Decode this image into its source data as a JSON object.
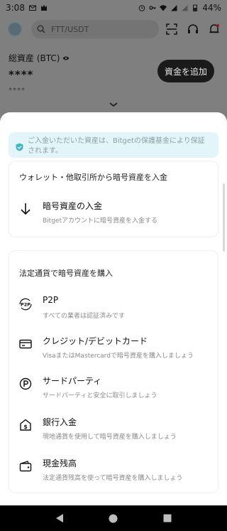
{
  "status_bar": {
    "time": "3:08",
    "battery": "44%"
  },
  "header": {
    "search_placeholder": "FTT/USDT"
  },
  "assets": {
    "label": "総資産 (BTC)",
    "value": "****",
    "sub_value": "****",
    "deposit_button": "資金を追加"
  },
  "sheet": {
    "notice": "ご入金いただいた資産は、Bitgetの保護基金により保証されます。",
    "wallet_section": {
      "title": "ウォレット・他取引所から暗号資産を入金",
      "items": [
        {
          "title": "暗号資産の入金",
          "description": "Bitgetアカウントに暗号資産を入金する",
          "icon": "arrow-down-icon"
        }
      ]
    },
    "fiat_section": {
      "title": "法定通貨で暗号資産を購入",
      "items": [
        {
          "title": "P2P",
          "description": "すべての業者は認証済みです",
          "icon": "p2p-icon"
        },
        {
          "title": "クレジット/デビットカード",
          "description": "VisaまたはMastercardで暗号資産を購入しましょう",
          "icon": "credit-card-icon"
        },
        {
          "title": "サードパーティ",
          "description": "サードパーティと安全に取引しましょう",
          "icon": "third-party-icon"
        },
        {
          "title": "銀行入金",
          "description": "現地通貨を使用して暗号資産を購入しましょう",
          "icon": "bank-icon"
        },
        {
          "title": "現金残高",
          "description": "法定通貨残高を使って暗号資産を購入しましょう",
          "icon": "wallet-icon"
        }
      ]
    }
  }
}
